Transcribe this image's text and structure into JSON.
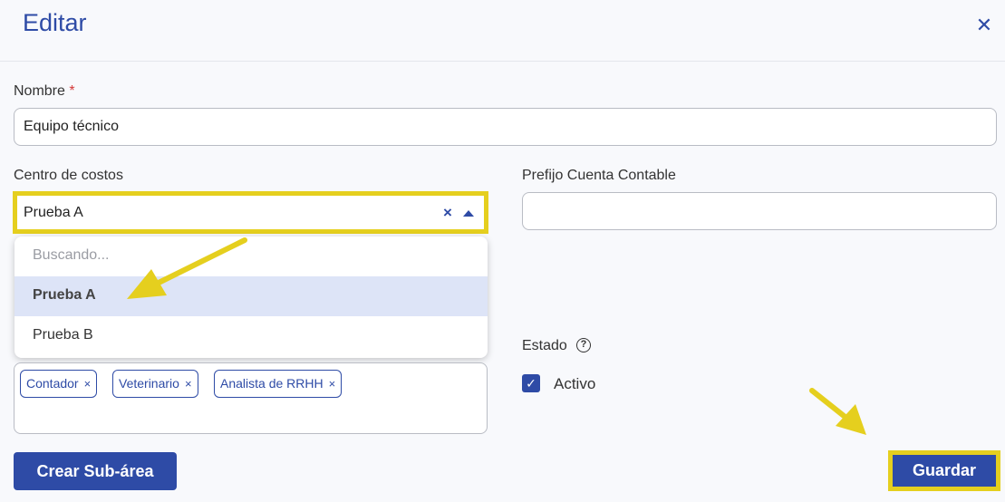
{
  "dialog": {
    "title": "Editar",
    "close_icon": "close-icon"
  },
  "form": {
    "nombre": {
      "label": "Nombre",
      "required_mark": "*",
      "value": "Equipo técnico"
    },
    "centro_costos": {
      "label": "Centro de costos",
      "value": "Prueba A",
      "clear_symbol": "×",
      "options": {
        "searching": "Buscando...",
        "items": [
          "Prueba A",
          "Prueba B"
        ]
      }
    },
    "prefijo": {
      "label": "Prefijo Cuenta Contable",
      "value": ""
    },
    "cargos": {
      "tags": [
        "Contador",
        "Veterinario",
        "Analista de RRHH"
      ],
      "remove_symbol": "×"
    },
    "estado": {
      "label": "Estado",
      "help_symbol": "?",
      "checkbox_label": "Activo",
      "checked": true,
      "check_symbol": "✓"
    }
  },
  "actions": {
    "create_sub_area": "Crear Sub-área",
    "save": "Guardar"
  },
  "colors": {
    "accent": "#2e4ba6",
    "highlight": "#e5cf1e",
    "selected_option": "#dde4f7"
  }
}
